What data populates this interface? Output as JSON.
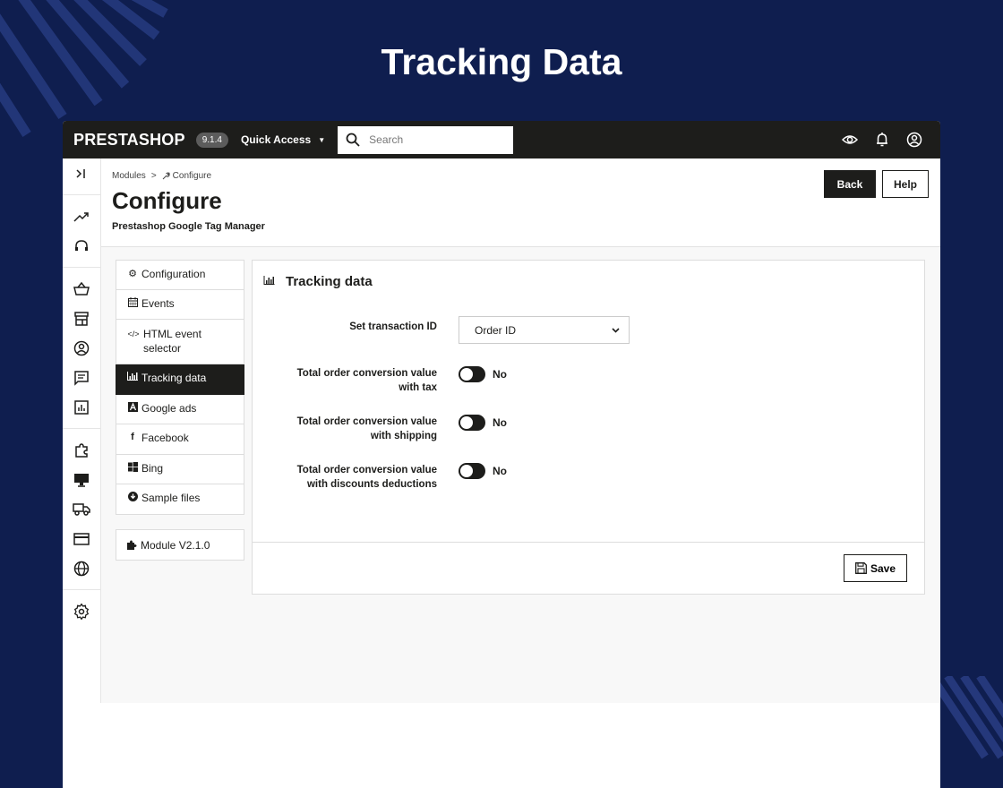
{
  "hero": {
    "title": "Tracking Data"
  },
  "topbar": {
    "logo": "PRESTASHOP",
    "version": "9.1.4",
    "quick_access": "Quick Access",
    "search_placeholder": "Search"
  },
  "breadcrumb": {
    "parent": "Modules",
    "separator": ">",
    "current": "Configure"
  },
  "header": {
    "title": "Configure",
    "subtitle": "Prestashop Google Tag Manager",
    "back_label": "Back",
    "help_label": "Help"
  },
  "tabs": [
    {
      "label": "Configuration",
      "icon": "cogs-icon"
    },
    {
      "label": "Events",
      "icon": "calendar-icon"
    },
    {
      "label": "HTML event selector",
      "icon": "code-icon"
    },
    {
      "label": "Tracking data",
      "icon": "bar-chart-icon",
      "active": true
    },
    {
      "label": "Google ads",
      "icon": "google-ads-icon"
    },
    {
      "label": "Facebook",
      "icon": "facebook-icon"
    },
    {
      "label": "Bing",
      "icon": "windows-icon"
    },
    {
      "label": "Sample files",
      "icon": "download-circle-icon"
    }
  ],
  "module_version": "Module V2.1.0",
  "panel": {
    "title": "Tracking data",
    "transaction": {
      "label": "Set transaction ID",
      "value": "Order ID"
    },
    "toggles": [
      {
        "label": "Total order conversion value with tax",
        "value": "No"
      },
      {
        "label": "Total order conversion value with shipping",
        "value": "No"
      },
      {
        "label": "Total order conversion value with discounts deductions",
        "value": "No"
      }
    ],
    "save_label": "Save"
  },
  "colors": {
    "background": "#0f1e4f",
    "topbar": "#1d1d1b",
    "accent": "#1d1d1b"
  }
}
